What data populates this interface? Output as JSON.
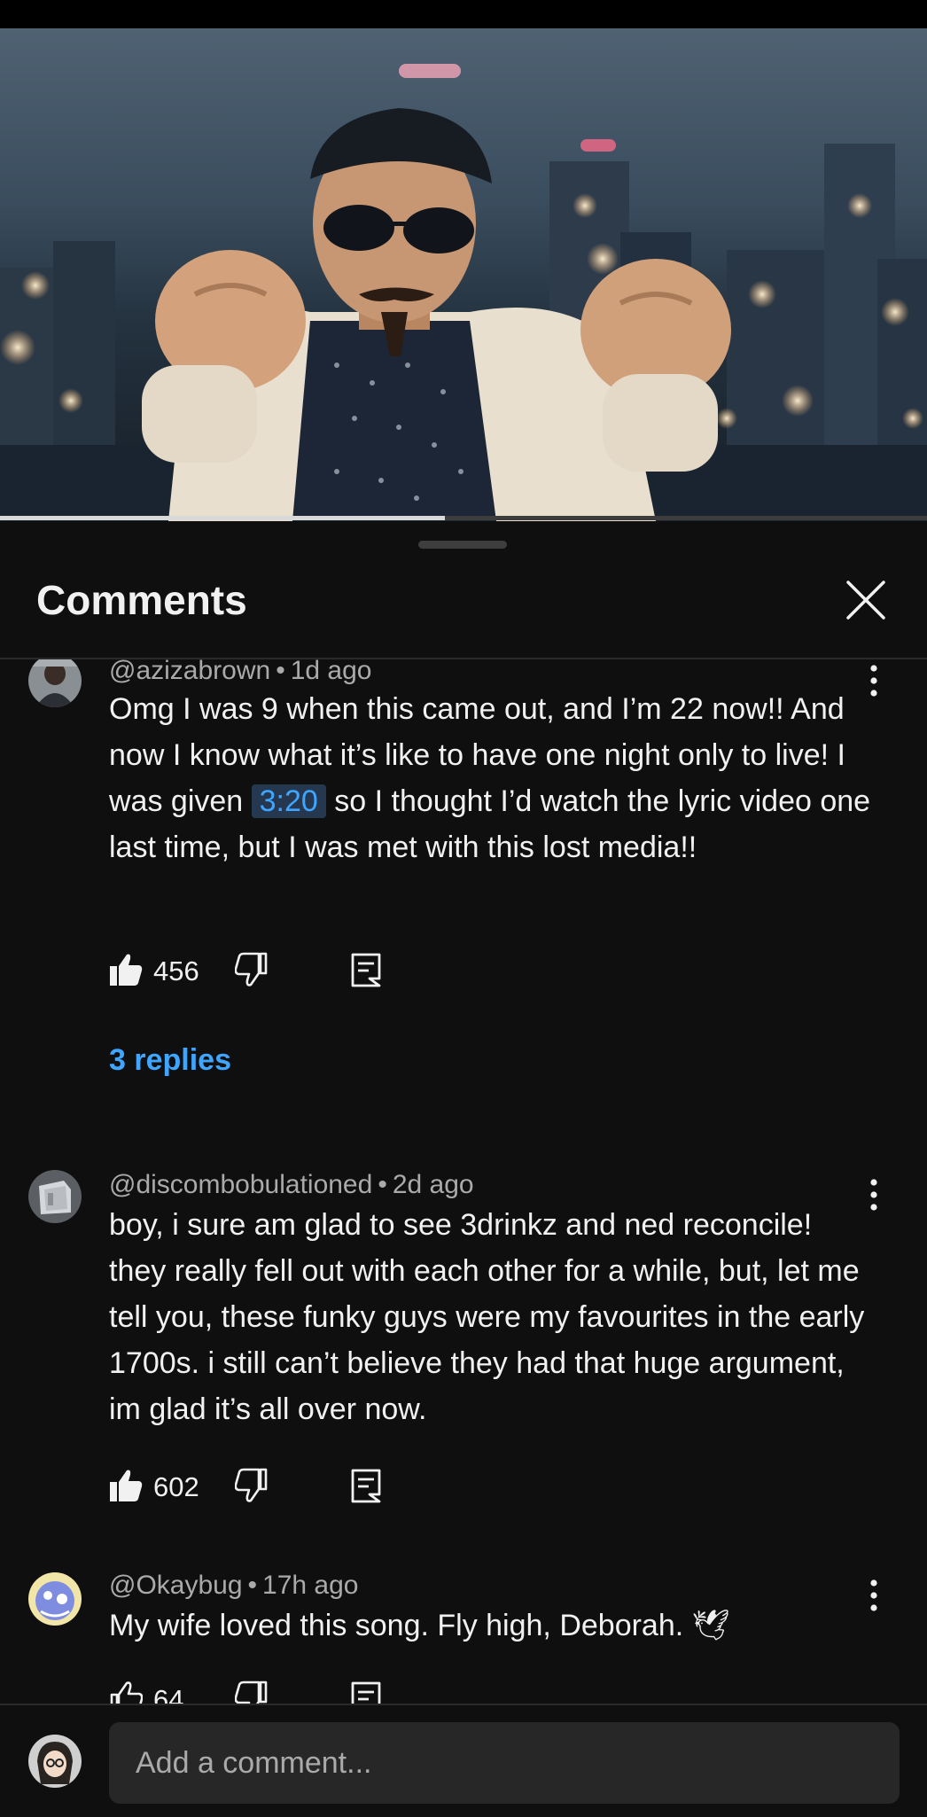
{
  "video": {
    "progress_fraction": 0.48
  },
  "comments_panel": {
    "title": "Comments",
    "items": [
      {
        "author": "@azizabrown",
        "time": "1d ago",
        "text_before": "Omg I was 9 when this came out, and I’m 22 now!! And now I know what it’s like to have one night only to live! I was given ",
        "timestamp_link": "3:20",
        "text_after": " so I thought I’d watch the lyric video one last time, but I was met with this lost media!!",
        "likes": "456",
        "replies_label": "3 replies"
      },
      {
        "author": "@discombobulationed",
        "time": "2d ago",
        "text": "boy, i sure am glad to see 3drinkz and ned reconcile! they really fell out with each other for a while, but, let me tell you, these funky guys were my favourites in the early 1700s. i still can’t believe they had that huge argument, im glad it’s all over now.",
        "likes": "602"
      },
      {
        "author": "@Okaybug",
        "time": "17h ago",
        "text": "My wife loved this song. Fly high, Deborah.",
        "emoji": "🕊",
        "likes": "64"
      }
    ]
  },
  "footer": {
    "input_placeholder": "Add a comment..."
  },
  "colors": {
    "background": "#0f0f0f",
    "text_primary": "#f1f1f1",
    "text_secondary": "#aaaaaa",
    "link_blue": "#3ea6ff",
    "input_bg": "#272727"
  }
}
